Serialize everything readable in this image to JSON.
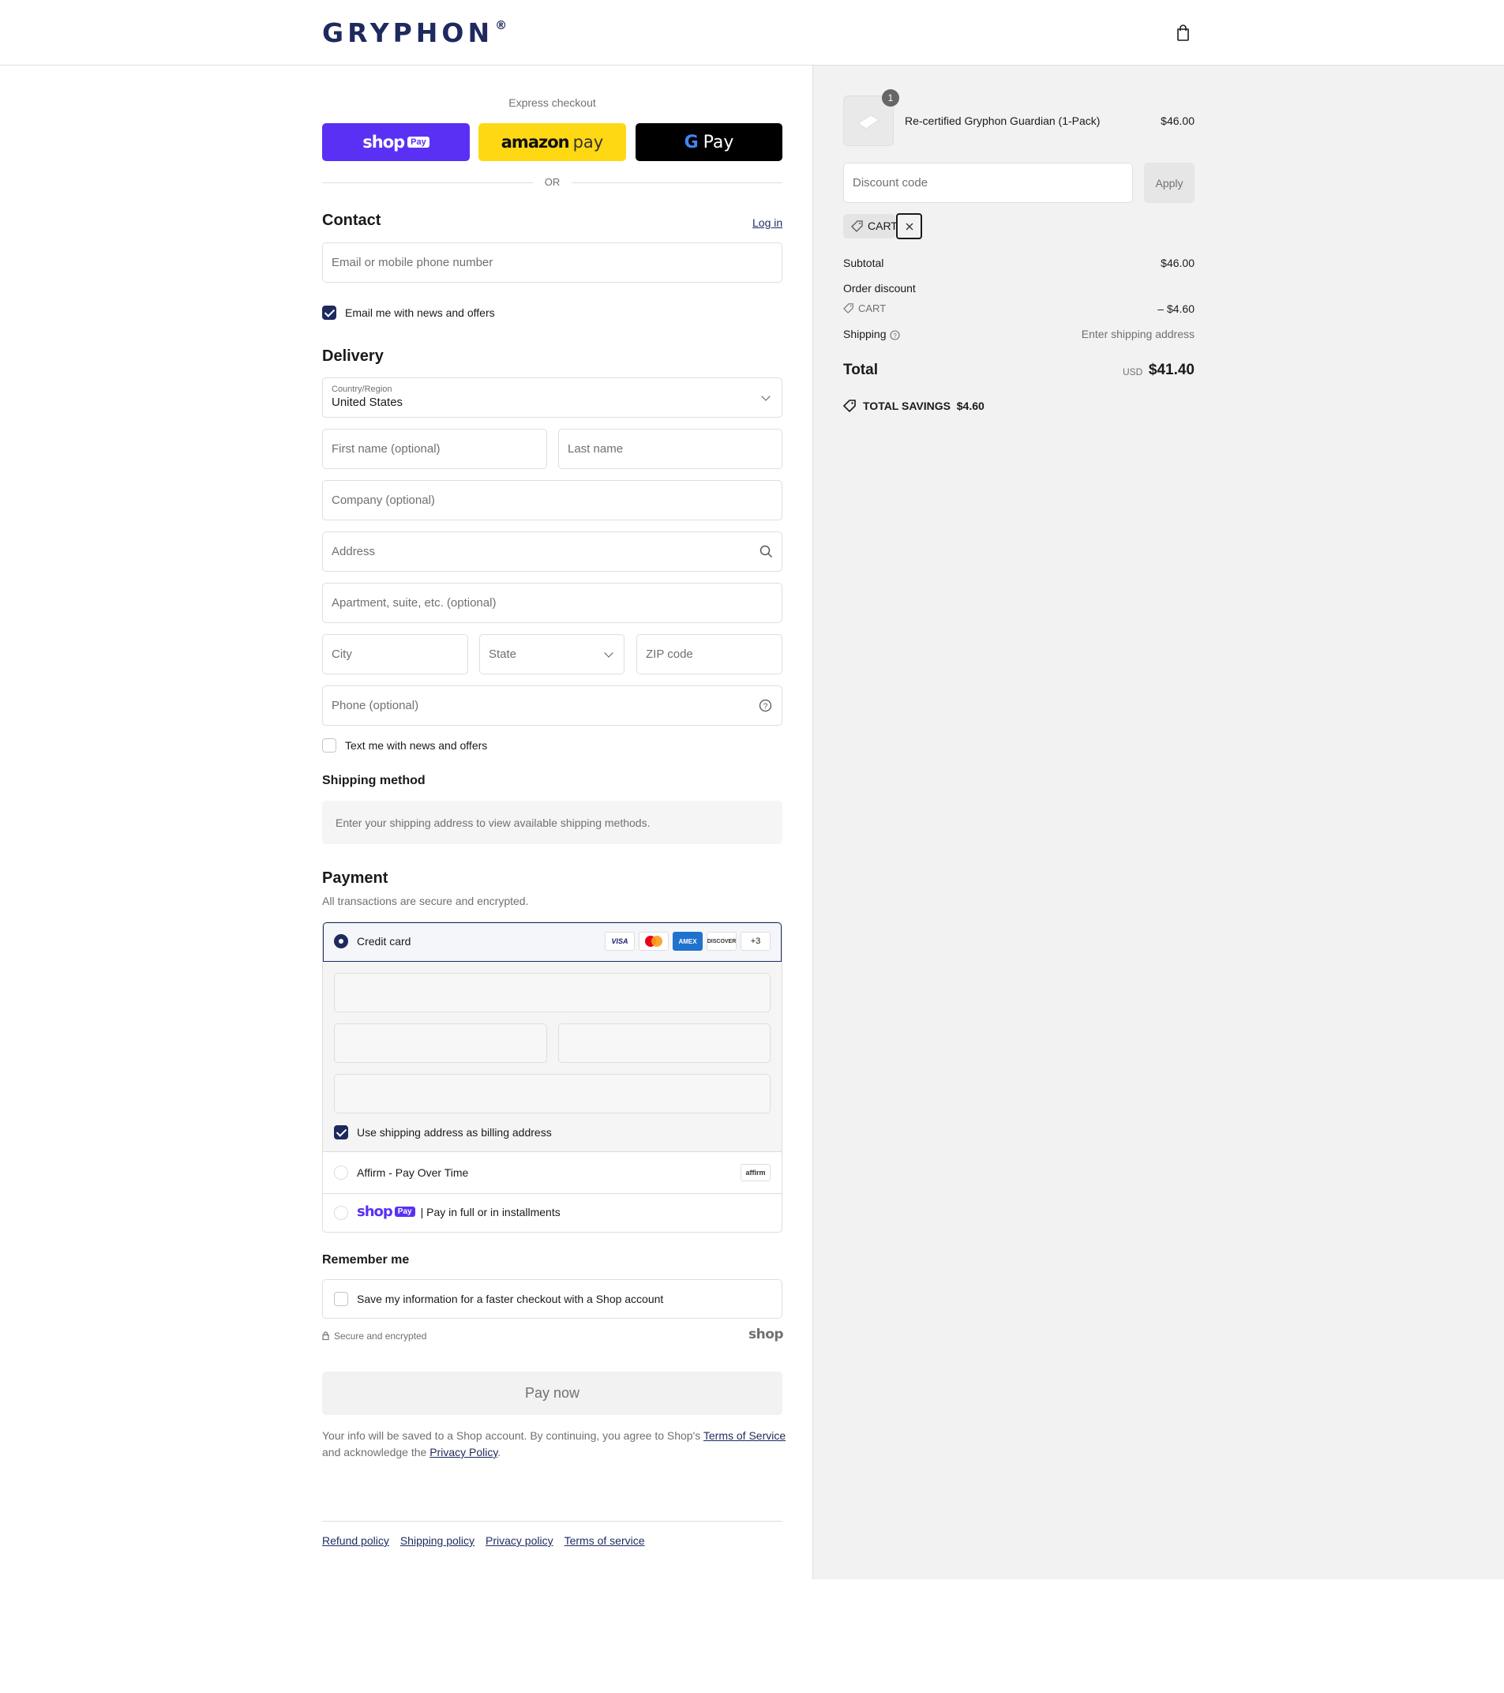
{
  "header": {
    "brand": "GRYPHON",
    "brand_mark": "®",
    "cart_icon": "bag-icon"
  },
  "express": {
    "title": "Express checkout",
    "shop_pay": {
      "word": "shop",
      "badge": "Pay"
    },
    "amazon_pay": {
      "word": "amazon",
      "suffix": "pay"
    },
    "google_pay": {
      "g": "G",
      "word": "Pay"
    },
    "or_label": "OR"
  },
  "contact": {
    "title": "Contact",
    "login_label": "Log in",
    "email_placeholder": "Email or mobile phone number",
    "news_label": "Email me with news and offers"
  },
  "delivery": {
    "title": "Delivery",
    "country_label": "Country/Region",
    "country_value": "United States",
    "first_name": "First name (optional)",
    "last_name": "Last name",
    "company": "Company (optional)",
    "address": "Address",
    "apartment": "Apartment, suite, etc. (optional)",
    "city": "City",
    "state": "State",
    "zip": "ZIP code",
    "phone": "Phone (optional)",
    "text_offers": "Text me with news and offers"
  },
  "shipping_method": {
    "title": "Shipping method",
    "notice": "Enter your shipping address to view available shipping methods."
  },
  "payment": {
    "title": "Payment",
    "subtitle": "All transactions are secure and encrypted.",
    "credit_card_label": "Credit card",
    "card_brands": [
      "VISA",
      "MC",
      "AMEX",
      "DISCOVER"
    ],
    "more_brands": "+3",
    "billing_same": "Use shipping address as billing address",
    "affirm_label": "Affirm - Pay Over Time",
    "affirm_logo": "affirm",
    "shop_pay_word": "shop",
    "shop_pay_badge": "Pay",
    "shop_pay_desc": "| Pay in full or in installments"
  },
  "remember": {
    "title": "Remember me",
    "save_label": "Save my information for a faster checkout with a Shop account",
    "secure_label": "Secure and encrypted",
    "shop_wordmark": "shop"
  },
  "pay_button": "Pay now",
  "legal": {
    "text1": "Your info will be saved to a Shop account. By continuing, you agree to Shop's",
    "terms": "Terms of Service",
    "text2": "and acknowledge the",
    "privacy": "Privacy Policy",
    "period": "."
  },
  "footer_links": [
    "Refund policy",
    "Shipping policy",
    "Privacy policy",
    "Terms of service"
  ],
  "summary": {
    "item_qty": "1",
    "item_name": "Re-certified Gryphon Guardian (1-Pack)",
    "item_price": "$46.00",
    "discount_placeholder": "Discount code",
    "apply_label": "Apply",
    "applied_code": "CART",
    "subtotal_label": "Subtotal",
    "subtotal_value": "$46.00",
    "order_discount_label": "Order discount",
    "discount_code": "CART",
    "discount_value": "– $4.60",
    "shipping_label": "Shipping",
    "shipping_value": "Enter shipping address",
    "total_label": "Total",
    "currency": "USD",
    "total_value": "$41.40",
    "savings_label": "TOTAL SAVINGS",
    "savings_value": "$4.60"
  }
}
